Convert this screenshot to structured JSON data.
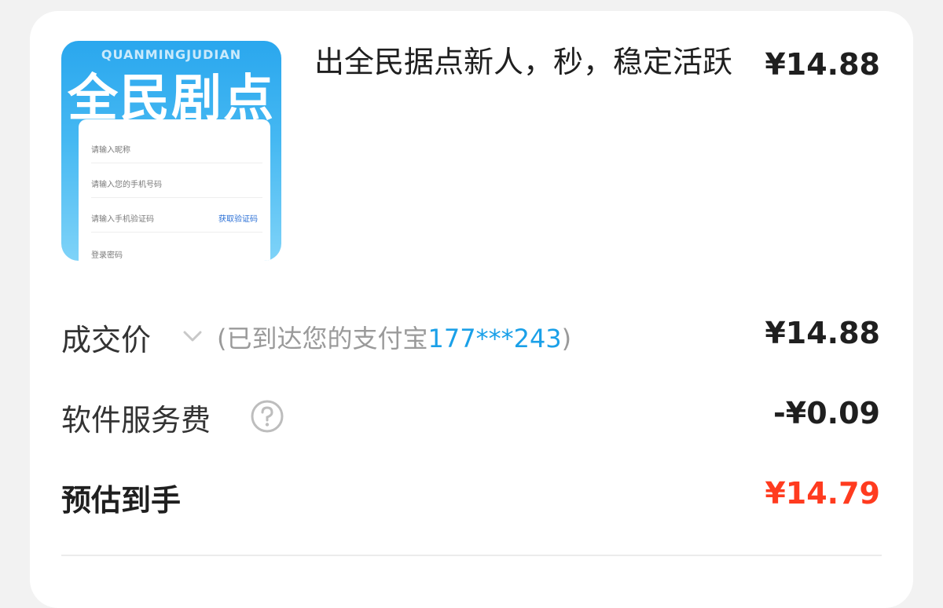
{
  "product": {
    "thumb_brand_en": "QUANMINGJUDIAN",
    "thumb_brand_cn": "全民剧点",
    "thumb_fields": [
      "请输入昵称",
      "请输入您的手机号码",
      "请输入手机验证码",
      "登录密码"
    ],
    "thumb_code_button": "获取验证码",
    "title": "出全民据点新人，秒，稳定活跃",
    "price": "¥14.88"
  },
  "rows": {
    "deal": {
      "label": "成交价",
      "note_prefix": "(已到达您的支付宝",
      "note_phone": "177***243",
      "note_suffix": ")",
      "amount": "¥14.88"
    },
    "fee": {
      "label": "软件服务费",
      "amount": "-¥0.09"
    },
    "net": {
      "label": "预估到手",
      "amount": "¥14.79"
    }
  },
  "colors": {
    "accent_red": "#ff3b1f",
    "phone_blue": "#1aa0e8",
    "thumb_blue": "#2aa7ee"
  },
  "icons": [
    "chevron-down-icon",
    "help-circle-icon"
  ]
}
